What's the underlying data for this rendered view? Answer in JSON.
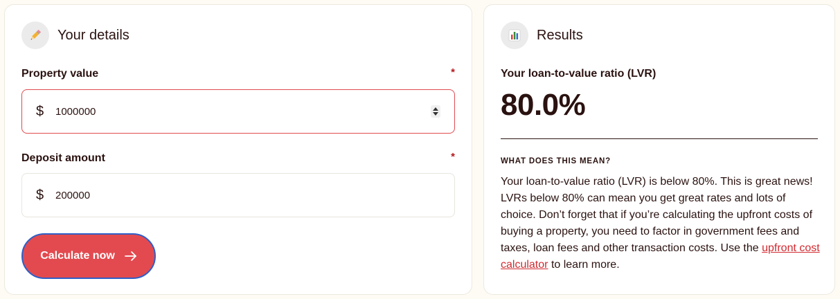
{
  "details": {
    "title": "Your details",
    "icon": "pencil-icon",
    "property": {
      "label": "Property value",
      "required_mark": "*",
      "currency": "$",
      "value": "1000000"
    },
    "deposit": {
      "label": "Deposit amount",
      "required_mark": "*",
      "currency": "$",
      "value": "200000"
    },
    "calculate_label": "Calculate now",
    "calculate_icon": "arrow-right-icon"
  },
  "results": {
    "title": "Results",
    "icon": "bar-chart-icon",
    "lvr_label": "Your loan-to-value ratio (LVR)",
    "lvr_value": "80.0%",
    "meaning_heading": "WHAT DOES THIS MEAN?",
    "meaning_text": "Your loan-to-value ratio (LVR) is below 80%. This is great news! LVRs below 80% can mean you get great rates and lots of choice. Don’t forget that if you’re calculating the upfront costs of buying a property, you need to factor in government fees and taxes, loan fees and other transaction costs. Use the",
    "meaning_link": "upfront cost calculator",
    "meaning_suffix": "to learn more."
  },
  "colors": {
    "accent": "#e34a4f",
    "text": "#2a1210",
    "required": "#b3191f",
    "link": "#d12a30",
    "focus_ring": "#2f5fc7"
  }
}
